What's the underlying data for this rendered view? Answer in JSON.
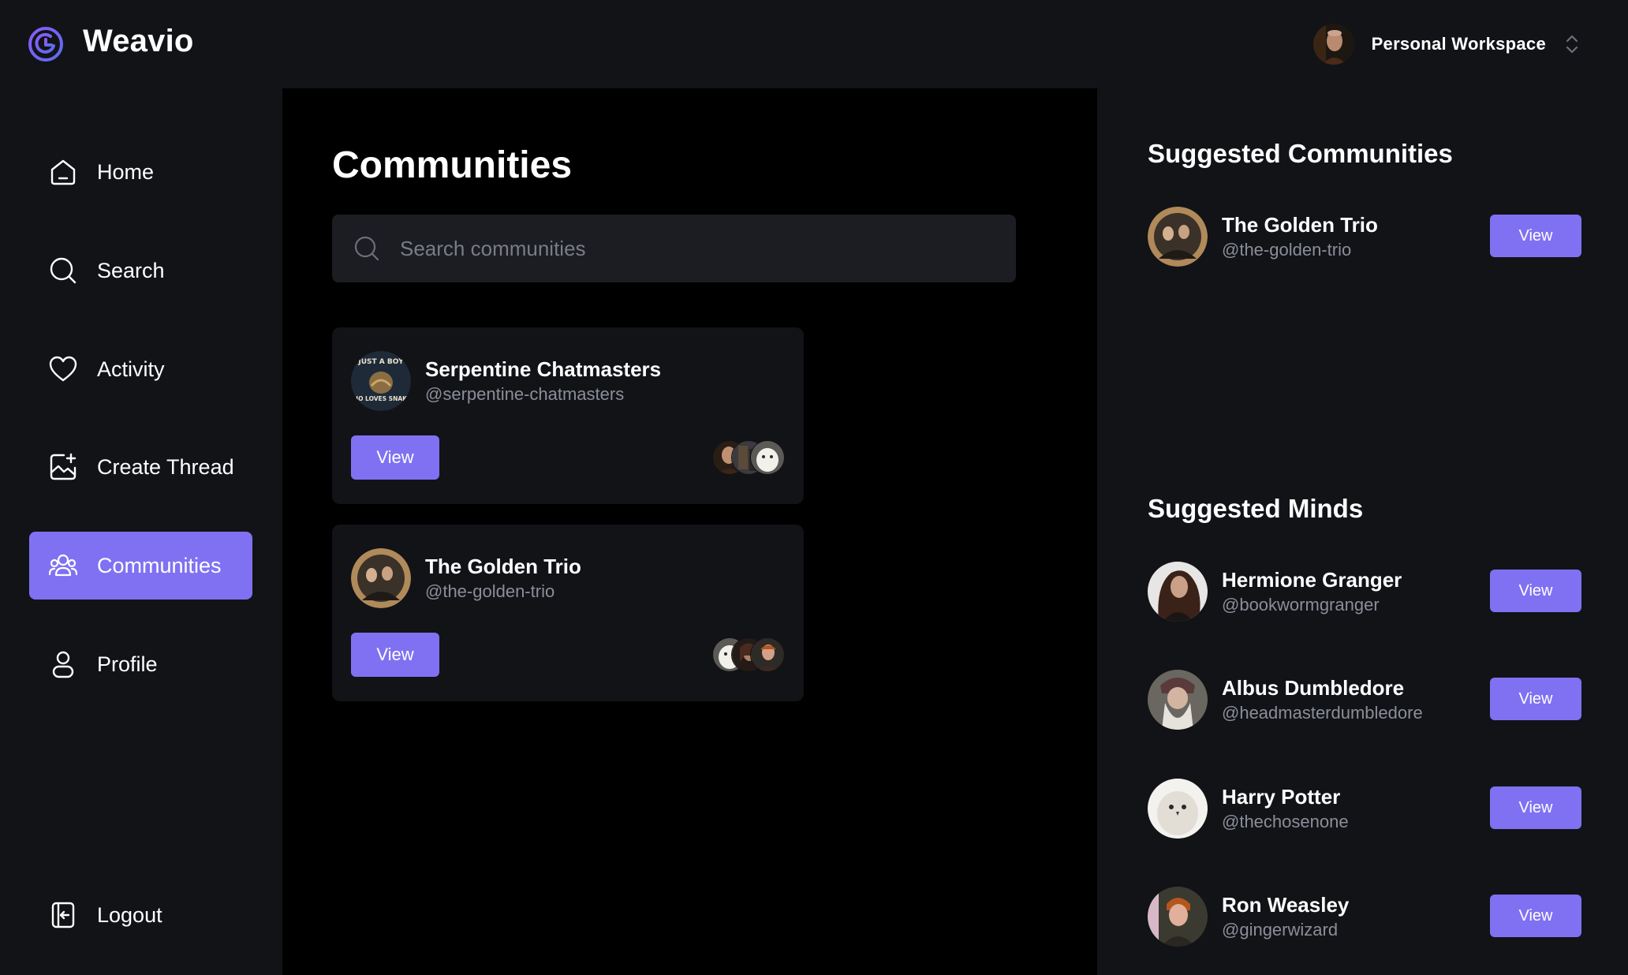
{
  "app": {
    "name": "Weavio"
  },
  "workspace": {
    "label": "Personal Workspace"
  },
  "sidebar": {
    "items": [
      {
        "label": "Home",
        "icon": "home-icon"
      },
      {
        "label": "Search",
        "icon": "search-icon"
      },
      {
        "label": "Activity",
        "icon": "heart-icon"
      },
      {
        "label": "Create Thread",
        "icon": "create-thread-icon"
      },
      {
        "label": "Communities",
        "icon": "communities-icon",
        "active": true
      },
      {
        "label": "Profile",
        "icon": "user-icon"
      }
    ],
    "logout": {
      "label": "Logout",
      "icon": "logout-icon"
    }
  },
  "main": {
    "title": "Communities",
    "search": {
      "placeholder": "Search communities",
      "value": ""
    },
    "communities": [
      {
        "name": "Serpentine Chatmasters",
        "handle": "@serpentine-chatmasters",
        "button": "View",
        "avatar_text_top": "JUST A BOY",
        "avatar_text_bottom": "WHO LOVES SNAKES"
      },
      {
        "name": "The Golden Trio",
        "handle": "@the-golden-trio",
        "button": "View"
      }
    ]
  },
  "right": {
    "suggested_communities": {
      "title": "Suggested Communities",
      "items": [
        {
          "name": "The Golden Trio",
          "handle": "@the-golden-trio",
          "button": "View"
        }
      ]
    },
    "suggested_minds": {
      "title": "Suggested Minds",
      "items": [
        {
          "name": "Hermione Granger",
          "handle": "@bookwormgranger",
          "button": "View"
        },
        {
          "name": "Albus Dumbledore",
          "handle": "@headmasterdumbledore",
          "button": "View"
        },
        {
          "name": "Harry Potter",
          "handle": "@thechosenone",
          "button": "View"
        },
        {
          "name": "Ron Weasley",
          "handle": "@gingerwizard",
          "button": "View"
        }
      ]
    }
  },
  "colors": {
    "accent": "#8071f2",
    "background": "#121317",
    "main_background": "#000000",
    "muted_text": "#8b8e99"
  }
}
